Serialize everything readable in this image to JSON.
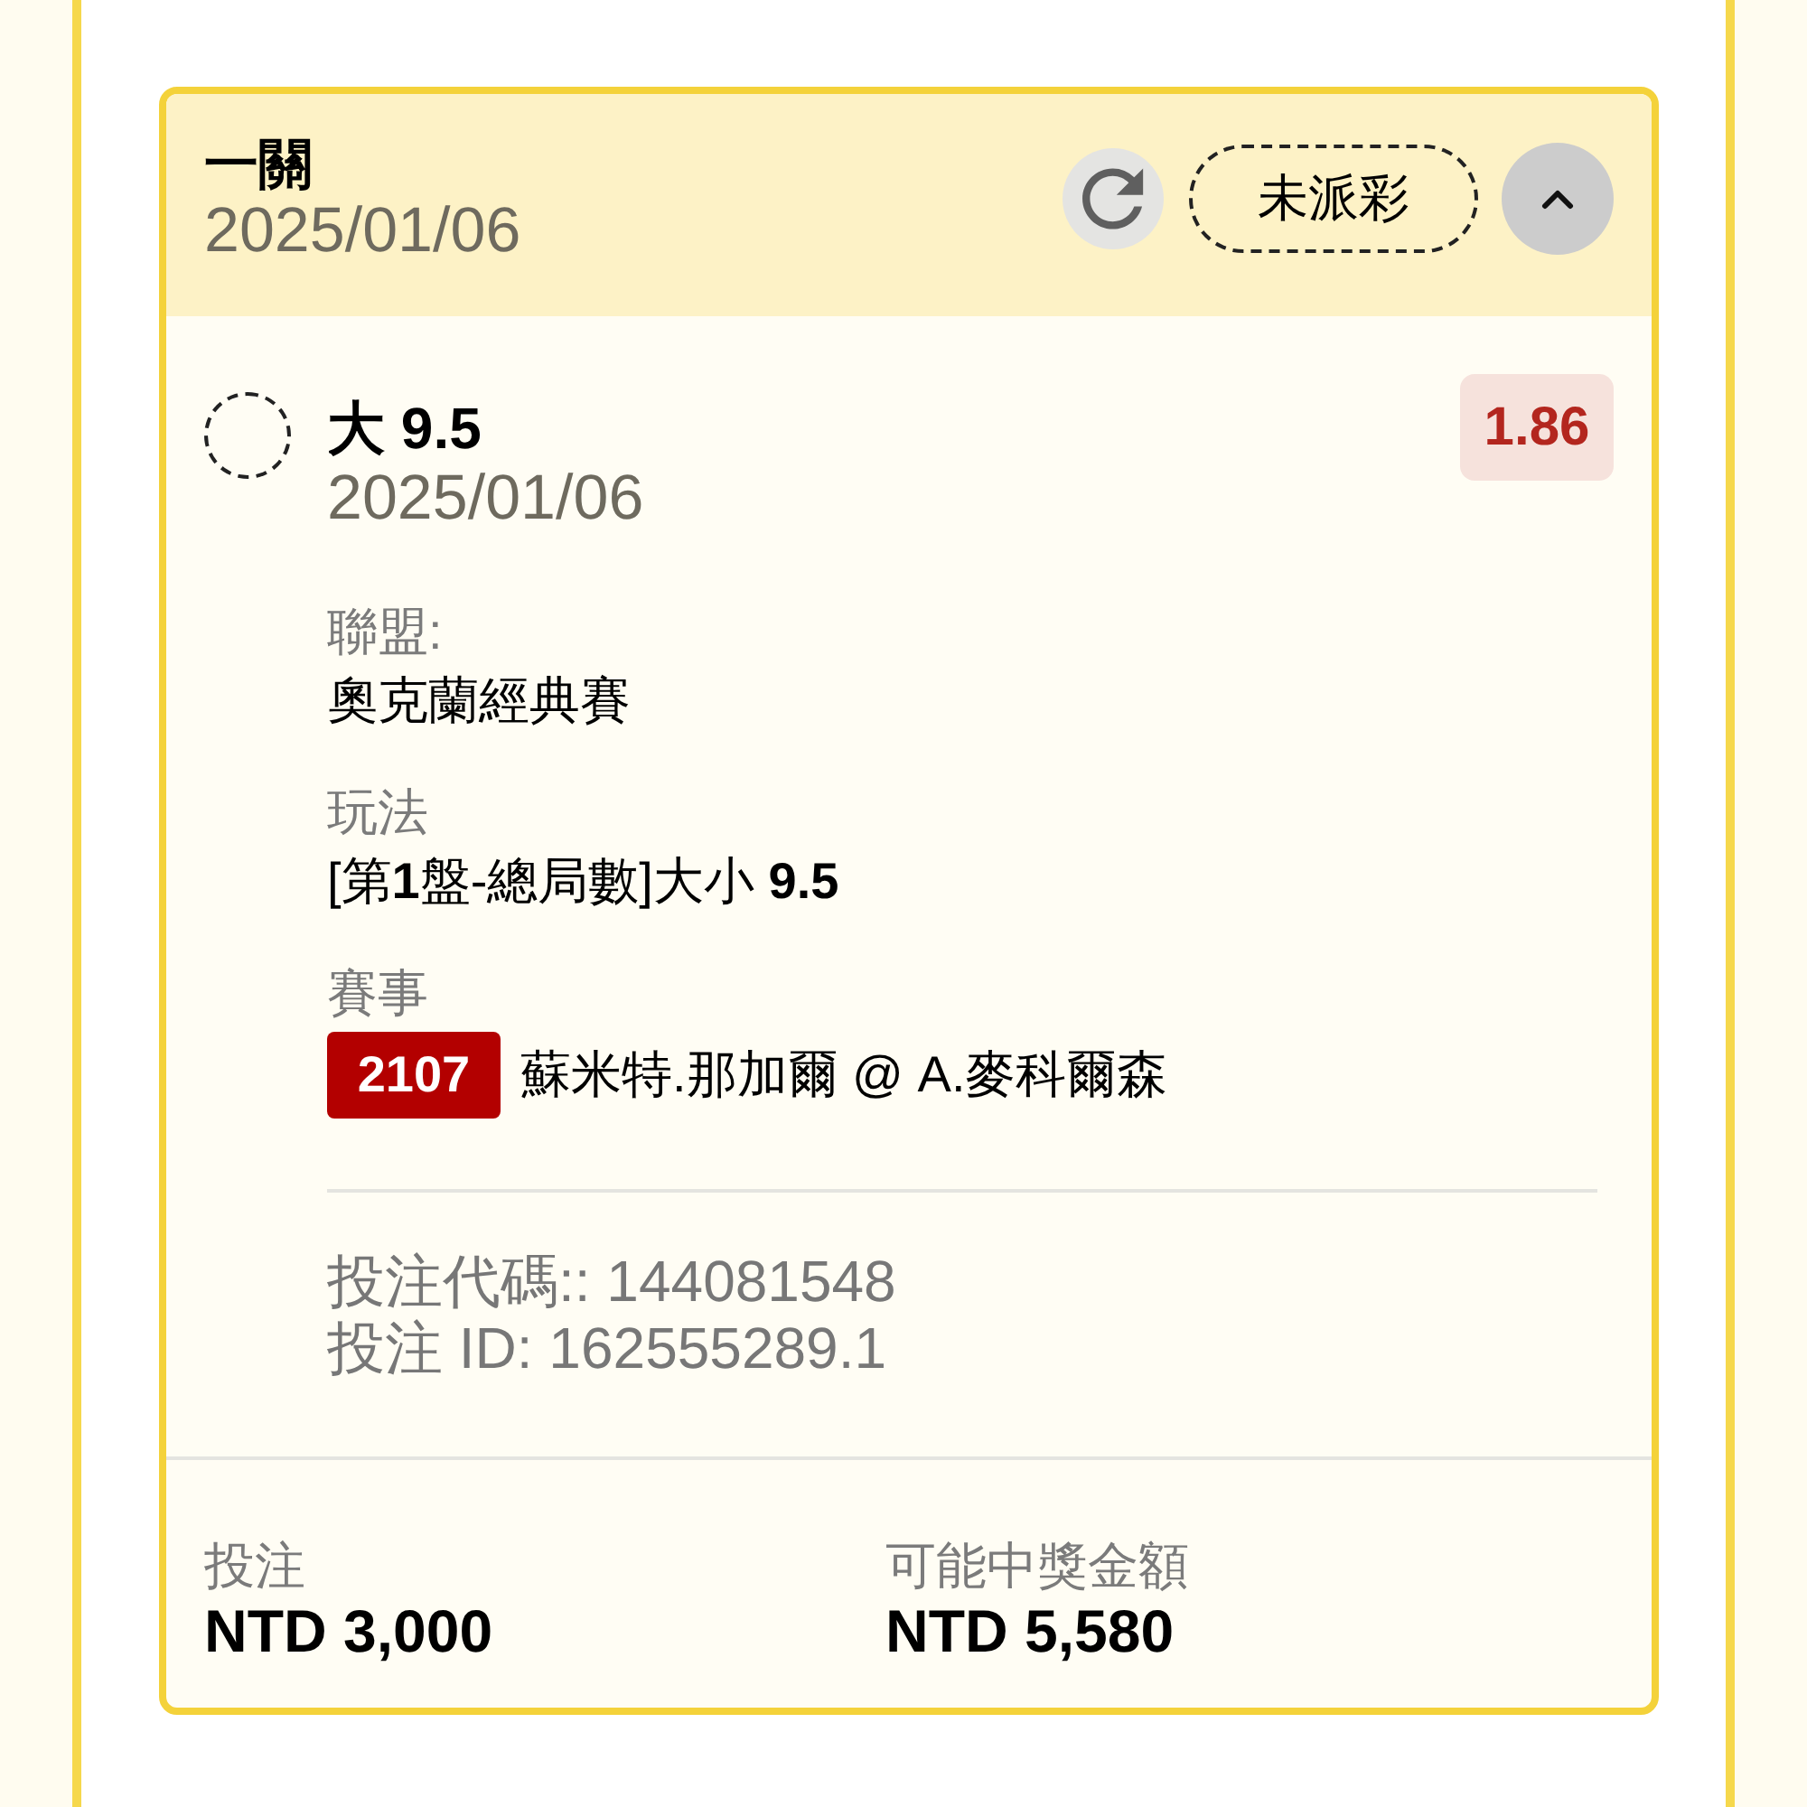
{
  "bet_card": {
    "header": {
      "title": "一關",
      "date": "2025/01/06",
      "status": "未派彩",
      "expanded": true
    },
    "selection": {
      "checked": false,
      "title": "大 9.5",
      "date": "2025/01/06",
      "odds": "1.86"
    },
    "details": [
      {
        "kind": "text",
        "label": "聯盟:",
        "value": "奧克蘭經典賽"
      },
      {
        "kind": "text",
        "label": "玩法",
        "value": "[第**1**盤-總局數]大小 **9.5**"
      },
      {
        "kind": "event",
        "label": "賽事",
        "code": "2107",
        "value": "蘇米特.那加爾 @ A.麥科爾森"
      }
    ],
    "references": [
      "投注代碼:: 144081548",
      "投注 ID: 162555289.1"
    ],
    "totals": [
      {
        "label": "投注",
        "value": "NTD 3,000"
      },
      {
        "label": "可能中獎金額",
        "value": "NTD 5,580"
      }
    ]
  }
}
